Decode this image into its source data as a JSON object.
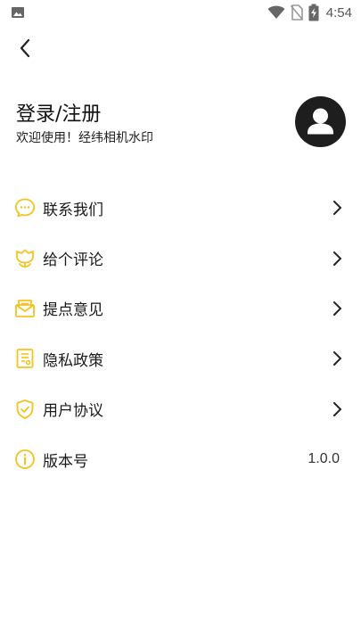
{
  "status_bar": {
    "time": "4:54",
    "icons": [
      "gallery-icon",
      "wifi-icon",
      "no-sim-icon",
      "battery-charging-icon"
    ]
  },
  "header": {
    "back_icon": "chevron-left-icon"
  },
  "profile": {
    "title": "登录/注册",
    "subtitle": "欢迎使用！经纬相机水印",
    "avatar_icon": "user-icon"
  },
  "menu": {
    "items": [
      {
        "label": "联系我们",
        "icon": "chat-bubble-icon",
        "action": "chevron-right-icon"
      },
      {
        "label": "给个评论",
        "icon": "flower-icon",
        "action": "chevron-right-icon"
      },
      {
        "label": "提点意见",
        "icon": "mail-icon",
        "action": "chevron-right-icon"
      },
      {
        "label": "隐私政策",
        "icon": "document-icon",
        "action": "chevron-right-icon"
      },
      {
        "label": "用户协议",
        "icon": "shield-check-icon",
        "action": "chevron-right-icon"
      },
      {
        "label": "版本号",
        "icon": "info-icon",
        "value": "1.0.0"
      }
    ]
  },
  "colors": {
    "accent": "#F7C21B",
    "text": "#1A1A1A",
    "avatar_bg": "#1E1E1E",
    "background": "#FFFFFF"
  }
}
